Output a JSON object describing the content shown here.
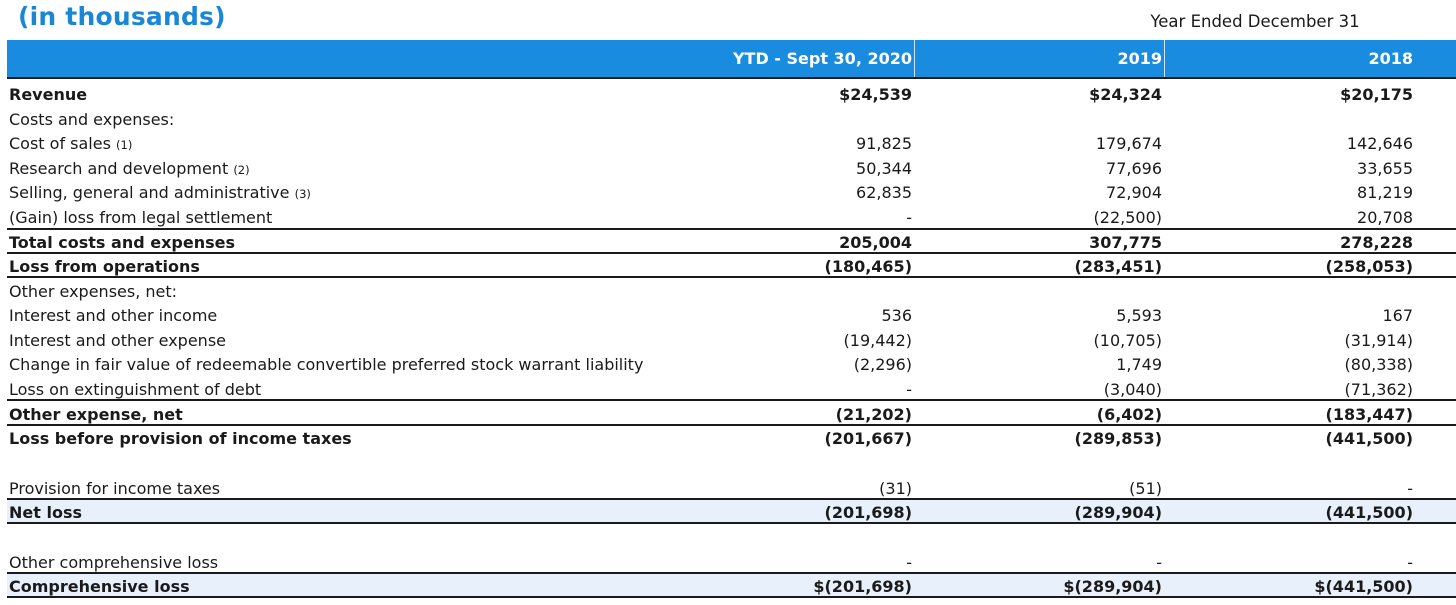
{
  "unit_note": "(in thousands)",
  "period_note": "Year Ended December 31",
  "columns": [
    "YTD - Sept 30, 2020",
    "2019",
    "2018"
  ],
  "rows": [
    {
      "label": "Revenue",
      "footnote": "",
      "bold": true,
      "values": [
        "$24,539",
        "$24,324",
        "$20,175"
      ]
    },
    {
      "label": "Costs and expenses:",
      "footnote": "",
      "bold": false,
      "values": [
        "",
        "",
        ""
      ]
    },
    {
      "label": "Cost of sales",
      "footnote": "(1)",
      "bold": false,
      "values": [
        "91,825",
        "179,674",
        "142,646"
      ]
    },
    {
      "label": "Research and development",
      "footnote": "(2)",
      "bold": false,
      "values": [
        "50,344",
        "77,696",
        "33,655"
      ]
    },
    {
      "label": "Selling, general and administrative",
      "footnote": "(3)",
      "bold": false,
      "values": [
        "62,835",
        "72,904",
        "81,219"
      ]
    },
    {
      "label": "(Gain) loss from legal settlement",
      "footnote": "",
      "bold": false,
      "values": [
        "-",
        "(22,500)",
        "20,708"
      ]
    },
    {
      "label": "Total costs and expenses",
      "footnote": "",
      "bold": true,
      "values": [
        "205,004",
        "307,775",
        "278,228"
      ]
    },
    {
      "label": "Loss from operations",
      "footnote": "",
      "bold": true,
      "values": [
        "(180,465)",
        "(283,451)",
        "(258,053)"
      ]
    },
    {
      "label": "Other expenses, net:",
      "footnote": "",
      "bold": false,
      "values": [
        "",
        "",
        ""
      ]
    },
    {
      "label": "Interest and other income",
      "footnote": "",
      "bold": false,
      "values": [
        "536",
        "5,593",
        "167"
      ]
    },
    {
      "label": "Interest and other expense",
      "footnote": "",
      "bold": false,
      "values": [
        "(19,442)",
        "(10,705)",
        "(31,914)"
      ]
    },
    {
      "label": "Change in fair value of redeemable convertible preferred stock warrant liability",
      "footnote": "",
      "bold": false,
      "values": [
        "(2,296)",
        "1,749",
        "(80,338)"
      ]
    },
    {
      "label": "Loss on extinguishment of debt",
      "footnote": "",
      "bold": false,
      "values": [
        "-",
        "(3,040)",
        "(71,362)"
      ]
    },
    {
      "label": "Other expense, net",
      "footnote": "",
      "bold": true,
      "values": [
        "(21,202)",
        "(6,402)",
        "(183,447)"
      ]
    },
    {
      "label": "Loss before provision of income taxes",
      "footnote": "",
      "bold": true,
      "values": [
        "(201,667)",
        "(289,853)",
        "(441,500)"
      ]
    },
    {
      "label": "Provision for income taxes",
      "footnote": "",
      "bold": false,
      "values": [
        "(31)",
        "(51)",
        "-"
      ]
    },
    {
      "label": "Net loss",
      "footnote": "",
      "bold": true,
      "values": [
        "(201,698)",
        "(289,904)",
        "(441,500)"
      ]
    },
    {
      "label": "Other comprehensive loss",
      "footnote": "",
      "bold": false,
      "values": [
        "-",
        "-",
        "-"
      ]
    },
    {
      "label": "Comprehensive loss",
      "footnote": "",
      "bold": true,
      "values": [
        "$(201,698)",
        "$(289,904)",
        "$(441,500)"
      ]
    }
  ]
}
